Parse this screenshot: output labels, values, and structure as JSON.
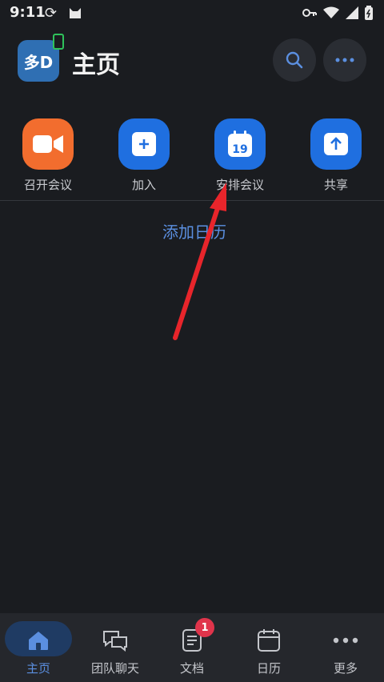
{
  "status_bar": {
    "time": "9:11"
  },
  "header": {
    "avatar_text": "多D",
    "title": "主页"
  },
  "actions": [
    {
      "label": "召开会议",
      "color": "#f26d2e",
      "icon": "video-camera-icon"
    },
    {
      "label": "加入",
      "color": "#1f6fe0",
      "icon": "plus-icon"
    },
    {
      "label": "安排会议",
      "color": "#1f6fe0",
      "icon": "calendar-icon",
      "calendar_day": "19"
    },
    {
      "label": "共享",
      "color": "#1f6fe0",
      "icon": "share-up-icon"
    }
  ],
  "main": {
    "add_calendar": "添加日历"
  },
  "tabs": [
    {
      "label": "主页",
      "active": true
    },
    {
      "label": "团队聊天"
    },
    {
      "label": "文档",
      "badge": "1"
    },
    {
      "label": "日历"
    },
    {
      "label": "更多"
    }
  ],
  "colors": {
    "accent": "#5b8fe0",
    "annotation_arrow": "#e8252b"
  }
}
